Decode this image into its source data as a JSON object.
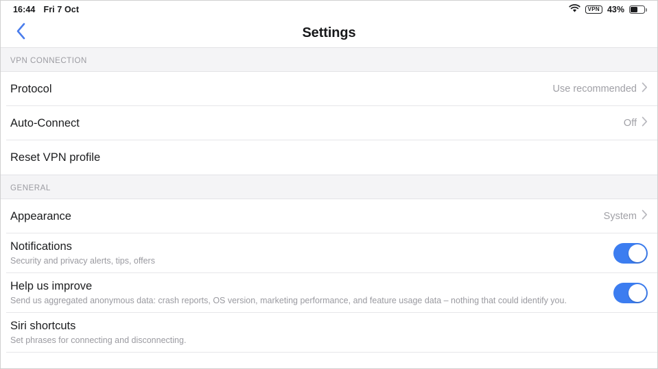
{
  "status_bar": {
    "time": "16:44",
    "date": "Fri 7 Oct",
    "wifi_icon": "wifi-icon",
    "vpn_badge": "VPN",
    "battery_percent": "43%",
    "battery_icon": "battery-icon"
  },
  "nav": {
    "back_icon": "chevron-left-icon",
    "title": "Settings",
    "accent_color": "#4a7dec"
  },
  "sections": [
    {
      "header": "VPN CONNECTION",
      "rows": [
        {
          "title": "Protocol",
          "subtitle": "",
          "value": "Use recommended",
          "accessory": "chevron"
        },
        {
          "title": "Auto-Connect",
          "subtitle": "",
          "value": "Off",
          "accessory": "chevron"
        },
        {
          "title": "Reset VPN profile",
          "subtitle": "",
          "value": "",
          "accessory": "none"
        }
      ]
    },
    {
      "header": "GENERAL",
      "rows": [
        {
          "title": "Appearance",
          "subtitle": "",
          "value": "System",
          "accessory": "chevron"
        },
        {
          "title": "Notifications",
          "subtitle": "Security and privacy alerts, tips, offers",
          "value": "",
          "accessory": "toggle",
          "toggle_on": true
        },
        {
          "title": "Help us improve",
          "subtitle": "Send us aggregated anonymous data: crash reports, OS version, marketing performance, and feature usage data  – nothing that could identify you.",
          "value": "",
          "accessory": "toggle",
          "toggle_on": true
        },
        {
          "title": "Siri shortcuts",
          "subtitle": "Set phrases for connecting and disconnecting.",
          "value": "",
          "accessory": "none"
        }
      ]
    }
  ],
  "colors": {
    "toggle_on": "#3c7df0",
    "section_header_bg": "#f4f4f6",
    "separator": "#e6e6e9",
    "primary_text": "#1b1c1e",
    "secondary_text": "#9a9aa0"
  }
}
